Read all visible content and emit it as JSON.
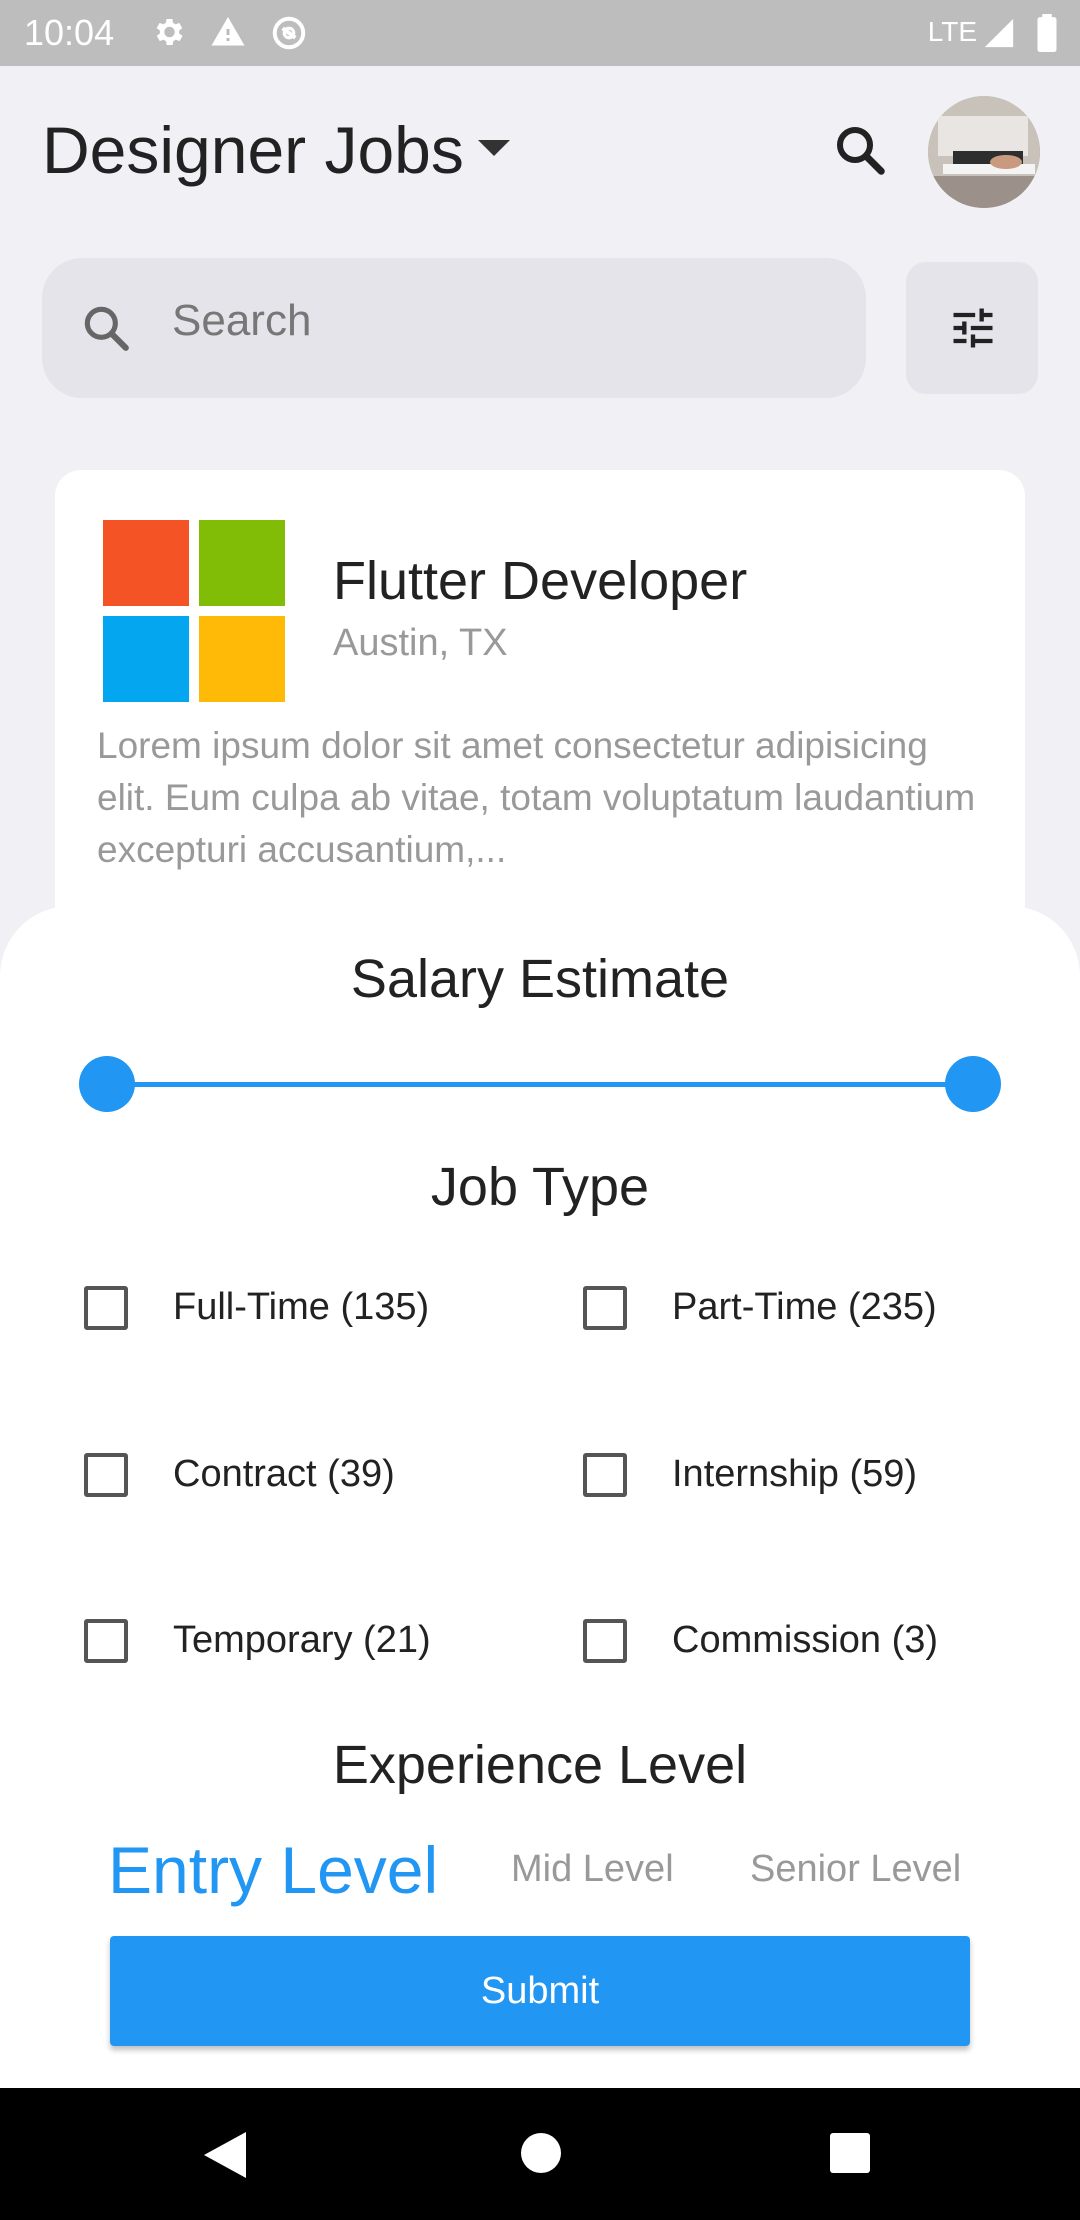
{
  "status_bar": {
    "time": "10:04",
    "network": "LTE",
    "icons": [
      "gear-icon",
      "warning-icon",
      "sync-icon",
      "signal-icon",
      "battery-icon"
    ]
  },
  "header": {
    "title": "Designer Jobs",
    "icons": [
      "dropdown-caret-icon",
      "search-icon",
      "avatar"
    ]
  },
  "search": {
    "placeholder": "Search",
    "filter_icon": "tune-icon"
  },
  "job_card": {
    "title": "Flutter Developer",
    "location": "Austin, TX",
    "description": "Lorem ipsum dolor sit amet consectetur adipisicing elit. Eum culpa ab vitae, totam voluptatum laudantium excepturi accusantium,...",
    "logo_colors": [
      "#f35325",
      "#81bc06",
      "#05a6f0",
      "#ffba08"
    ]
  },
  "filter_sheet": {
    "salary_title": "Salary Estimate",
    "job_type_title": "Job Type",
    "job_types": [
      {
        "label": "Full-Time (135)",
        "checked": false
      },
      {
        "label": "Part-Time (235)",
        "checked": false
      },
      {
        "label": "Contract (39)",
        "checked": false
      },
      {
        "label": "Internship (59)",
        "checked": false
      },
      {
        "label": "Temporary (21)",
        "checked": false
      },
      {
        "label": "Commission (3)",
        "checked": false
      }
    ],
    "experience_title": "Experience Level",
    "levels": [
      {
        "label": "Entry Level",
        "selected": true
      },
      {
        "label": "Mid Level",
        "selected": false
      },
      {
        "label": "Senior Level",
        "selected": false
      }
    ],
    "submit_label": "Submit",
    "accent_color": "#2196f3"
  },
  "nav_bar": {
    "icons": [
      "back-icon",
      "home-icon",
      "recents-icon"
    ]
  }
}
